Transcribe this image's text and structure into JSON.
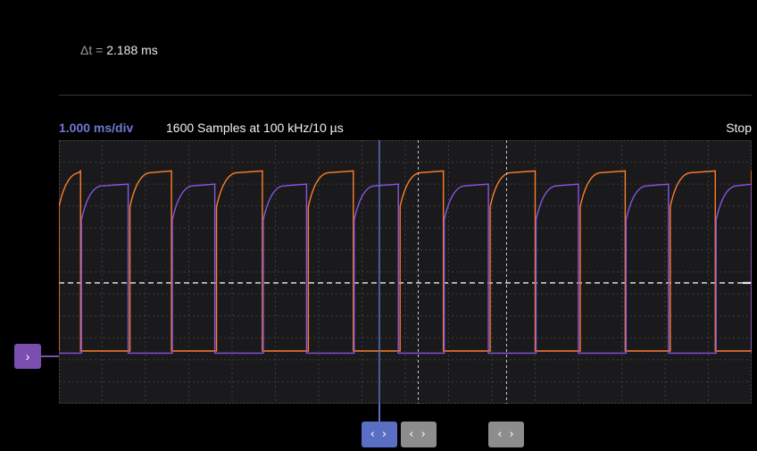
{
  "measurement": {
    "symbol": "Δt",
    "equals": " = ",
    "value": "2.188 ms"
  },
  "status": {
    "time_div": "1.000 ms/div",
    "samples": "1600 Samples at 100 kHz/10 µs",
    "run_state": "Stop"
  },
  "cursors": [
    {
      "name": "cursor-1",
      "label": "‹ ›",
      "active": true,
      "time_ms": 3.7
    },
    {
      "name": "cursor-2",
      "label": "‹ ›",
      "active": false,
      "time_ms": 4.15
    },
    {
      "name": "cursor-3",
      "label": "‹ ›",
      "active": false,
      "time_ms": 5.17
    }
  ],
  "reference_marker": {
    "label": "›"
  },
  "chart_data": {
    "type": "line",
    "grid": true,
    "xlim_divs": [
      0,
      8
    ],
    "ylim_divs": [
      0,
      6
    ],
    "center_level_div": 2.75,
    "series": [
      {
        "color": "#ff7f2a",
        "high_div": 5.3,
        "low_div": 1.2,
        "high_x": [
          [
            0.0,
            0.25
          ],
          [
            0.82,
            1.3
          ],
          [
            1.82,
            2.35
          ],
          [
            2.88,
            3.4
          ],
          [
            3.94,
            4.44
          ],
          [
            4.98,
            5.5
          ],
          [
            6.02,
            6.54
          ],
          [
            7.06,
            7.58
          ],
          [
            8.1,
            8.0
          ]
        ]
      },
      {
        "color": "#8a55e0",
        "high_div": 5.0,
        "low_div": 1.15,
        "high_x": [
          [
            0.26,
            0.8
          ],
          [
            1.31,
            1.8
          ],
          [
            2.36,
            2.86
          ],
          [
            3.41,
            3.92
          ],
          [
            4.45,
            4.96
          ],
          [
            5.51,
            6.0
          ],
          [
            6.55,
            7.04
          ],
          [
            7.59,
            8.0
          ]
        ]
      }
    ]
  }
}
